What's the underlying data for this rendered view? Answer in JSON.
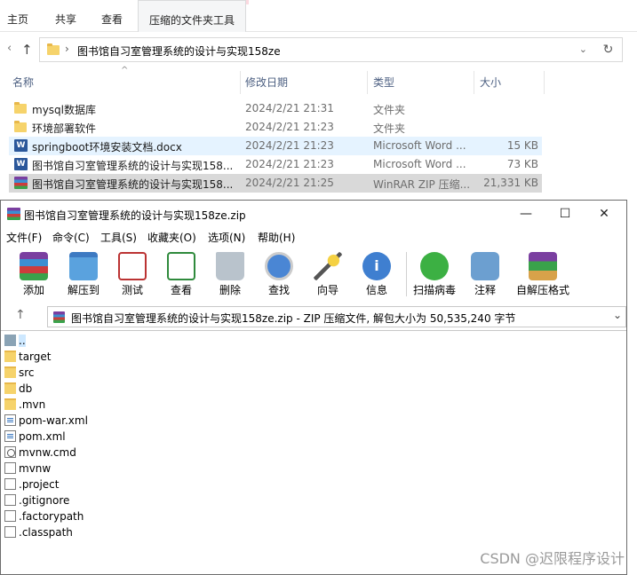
{
  "ribbon": {
    "tabs": [
      "主页",
      "共享",
      "查看"
    ],
    "context_tab": "压缩的文件夹工具"
  },
  "address": {
    "path": "图书馆自习室管理系统的设计与实现158ze"
  },
  "columns": {
    "name": "名称",
    "date": "修改日期",
    "type": "类型",
    "size": "大小"
  },
  "files": [
    {
      "name": "mysql数据库",
      "date": "2024/2/21 21:31",
      "type": "文件夹",
      "size": "",
      "icon": "folder-icon"
    },
    {
      "name": "环境部署软件",
      "date": "2024/2/21 21:23",
      "type": "文件夹",
      "size": "",
      "icon": "folder-icon"
    },
    {
      "name": "springboot环境安装文档.docx",
      "date": "2024/2/21 21:23",
      "type": "Microsoft Word ...",
      "size": "15 KB",
      "icon": "word-icon"
    },
    {
      "name": "图书馆自习室管理系统的设计与实现158...",
      "date": "2024/2/21 21:23",
      "type": "Microsoft Word ...",
      "size": "73 KB",
      "icon": "word-icon"
    },
    {
      "name": "图书馆自习室管理系统的设计与实现158...",
      "date": "2024/2/21 21:25",
      "type": "WinRAR ZIP 压缩...",
      "size": "21,331 KB",
      "icon": "winrar-icon"
    }
  ],
  "winrar": {
    "title": "图书馆自习室管理系统的设计与实现158ze.zip",
    "menu": [
      "文件(F)",
      "命令(C)",
      "工具(S)",
      "收藏夹(O)",
      "选项(N)",
      "帮助(H)"
    ],
    "toolbar": [
      "添加",
      "解压到",
      "测试",
      "查看",
      "删除",
      "查找",
      "向导",
      "信息",
      "扫描病毒",
      "注释",
      "自解压格式"
    ],
    "path_text": "图书馆自习室管理系统的设计与实现158ze.zip - ZIP 压缩文件, 解包大小为 50,535,240 字节",
    "entries": [
      {
        "name": "..",
        "kind": "up"
      },
      {
        "name": "target",
        "kind": "folder"
      },
      {
        "name": "src",
        "kind": "folder"
      },
      {
        "name": "db",
        "kind": "folder"
      },
      {
        "name": ".mvn",
        "kind": "folder"
      },
      {
        "name": "pom-war.xml",
        "kind": "xml"
      },
      {
        "name": "pom.xml",
        "kind": "xml"
      },
      {
        "name": "mvnw.cmd",
        "kind": "cmd"
      },
      {
        "name": "mvnw",
        "kind": "file"
      },
      {
        "name": ".project",
        "kind": "file"
      },
      {
        "name": ".gitignore",
        "kind": "file"
      },
      {
        "name": ".factorypath",
        "kind": "file"
      },
      {
        "name": ".classpath",
        "kind": "file"
      }
    ]
  },
  "watermark": "CSDN @迟限程序设计"
}
